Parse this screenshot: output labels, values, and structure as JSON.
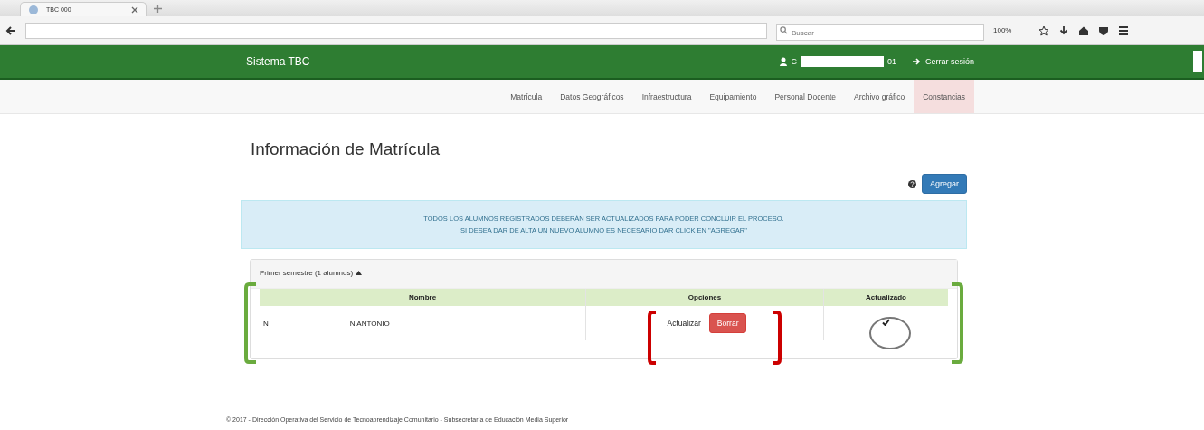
{
  "browser": {
    "tab_title": "TBC 000",
    "search_placeholder": "Buscar",
    "zoom": "100%"
  },
  "navbar": {
    "brand": "Sistema TBC",
    "user_start": "C",
    "user_end": "01",
    "logout": "Cerrar sesión"
  },
  "menu": [
    {
      "label": "Matrícula",
      "selected": false
    },
    {
      "label": "Datos Geográficos",
      "selected": false
    },
    {
      "label": "Infraestructura",
      "selected": false
    },
    {
      "label": "Equipamiento",
      "selected": false
    },
    {
      "label": "Personal Docente",
      "selected": false
    },
    {
      "label": "Archivo gráfico",
      "selected": false
    },
    {
      "label": "Constancias",
      "selected": true
    }
  ],
  "page_title": "Información de Matrícula",
  "add_button": "Agregar",
  "alert": [
    "TODOS LOS ALUMNOS REGISTRADOS DEBERÁN SER ACTUALIZADOS PARA PODER CONCLUIR EL PROCESO.",
    "SI DESEA DAR DE ALTA UN NUEVO ALUMNO ES NECESARIO DAR CLICK EN \"AGREGAR\""
  ],
  "panel": {
    "heading": "Primer semestre (1 alumnos)",
    "expanded": true,
    "table": {
      "columns": [
        "Nombre",
        "Opciones",
        "Actualizado"
      ],
      "rows": [
        {
          "name_start": "N",
          "name_end": "N ANTONIO",
          "update": "Actualizar",
          "delete": "Borrar",
          "updated": true
        }
      ]
    }
  },
  "footer": "© 2017 - Dirección Operativa del Servicio de Tecnoaprendizaje Comunitario - Subsecretaría de Educación Media Superior"
}
